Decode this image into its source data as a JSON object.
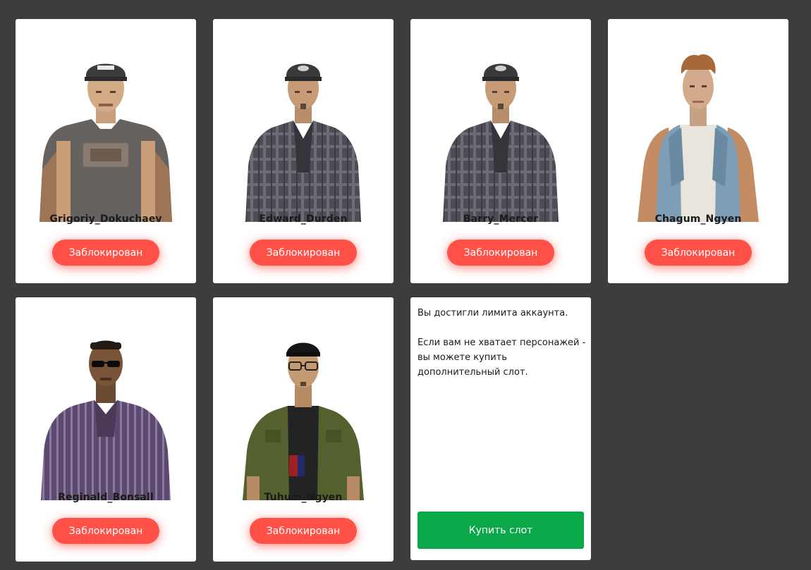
{
  "characters": [
    {
      "name": "Grigoriy_Dokuchaev",
      "status": "Заблокирован"
    },
    {
      "name": "Edward_Durden",
      "status": "Заблокирован"
    },
    {
      "name": "Barry_Mercer",
      "status": "Заблокирован"
    },
    {
      "name": "Chagum_Ngyen",
      "status": "Заблокирован"
    },
    {
      "name": "Reginald_Bonsall",
      "status": "Заблокирован"
    },
    {
      "name": "Tuhum_Ngyen",
      "status": "Заблокирован"
    }
  ],
  "limit": {
    "line1": "Вы достигли лимита аккаунта.",
    "line2": "Если вам не хватает персонажей - вы можете купить дополнительный слот.",
    "buy_label": "Купить слот"
  },
  "colors": {
    "background": "#3c3d3f",
    "locked_button": "#ff5148",
    "buy_button": "#0ba84a"
  }
}
